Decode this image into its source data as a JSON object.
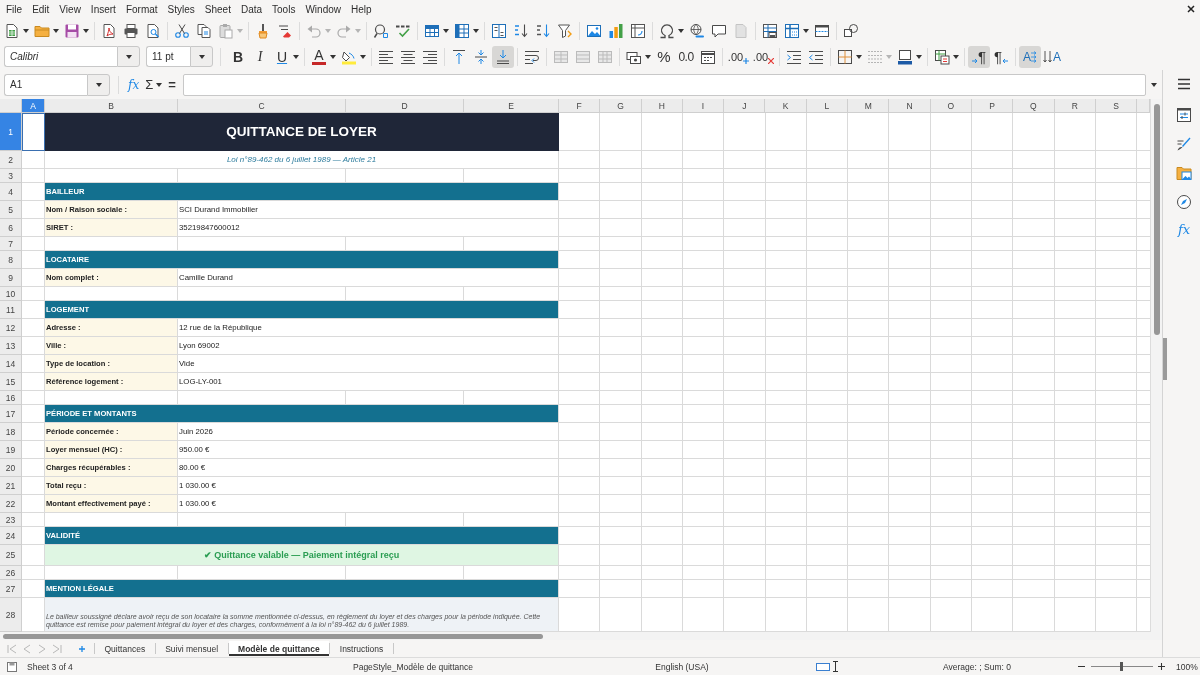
{
  "menu_bar": {
    "items": [
      "File",
      "Edit",
      "View",
      "Insert",
      "Format",
      "Styles",
      "Sheet",
      "Data",
      "Tools",
      "Window",
      "Help"
    ]
  },
  "formatting_toolbar": {
    "font_name": "Calibri",
    "font_size": "11 pt",
    "bold": "B",
    "italic": "I",
    "underline": "U",
    "font_color": "A",
    "align_top": {
      "on": false
    },
    "align_center": {
      "on": false
    },
    "align_bottom": {
      "on": true
    },
    "percent": "%",
    "number": "0.0",
    "add_decimal": ".00",
    "delete_decimal": ".00",
    "left_to_right": {
      "glyph": "¶",
      "on": true
    },
    "right_to_left": {
      "glyph": "¶",
      "on": false
    },
    "text_horizontal": {
      "glyph": "A",
      "on": true
    },
    "text_vertical": {
      "glyph": "A",
      "on": false
    }
  },
  "formula_bar": {
    "name_box": "A1",
    "function_wizard": "fx",
    "sum": "Σ",
    "formula": "="
  },
  "sidebar": {
    "functions": "fx"
  },
  "sheet": {
    "columns": [
      {
        "label": "A",
        "selected": true
      },
      {
        "label": "B",
        "selected": false
      },
      {
        "label": "C",
        "selected": false
      },
      {
        "label": "D",
        "selected": false
      },
      {
        "label": "E",
        "selected": false
      },
      {
        "label": "F",
        "selected": false
      },
      {
        "label": "G",
        "selected": false
      },
      {
        "label": "H",
        "selected": false
      },
      {
        "label": "I",
        "selected": false
      },
      {
        "label": "J",
        "selected": false
      },
      {
        "label": "K",
        "selected": false
      },
      {
        "label": "L",
        "selected": false
      },
      {
        "label": "M",
        "selected": false
      },
      {
        "label": "N",
        "selected": false
      },
      {
        "label": "O",
        "selected": false
      },
      {
        "label": "P",
        "selected": false
      },
      {
        "label": "Q",
        "selected": false
      },
      {
        "label": "R",
        "selected": false
      },
      {
        "label": "S",
        "selected": false
      }
    ],
    "rows": [
      {
        "number": "1",
        "selected": true,
        "kind": "title",
        "text": "QUITTANCE DE LOYER"
      },
      {
        "number": "2",
        "selected": false,
        "kind": "subtitle",
        "text": "Loi n°89-462 du 6 juillet 1989 — Article 21"
      },
      {
        "number": "3",
        "selected": false,
        "kind": "blank"
      },
      {
        "number": "4",
        "selected": false,
        "kind": "section",
        "text": "BAILLEUR"
      },
      {
        "number": "5",
        "selected": false,
        "kind": "field",
        "label": "Nom / Raison sociale :",
        "value": "SCI Durand Immobilier"
      },
      {
        "number": "6",
        "selected": false,
        "kind": "field",
        "label": "SIRET :",
        "value": "35219847600012"
      },
      {
        "number": "7",
        "selected": false,
        "kind": "blank"
      },
      {
        "number": "8",
        "selected": false,
        "kind": "section",
        "text": "LOCATAIRE"
      },
      {
        "number": "9",
        "selected": false,
        "kind": "field",
        "label": "Nom complet :",
        "value": "Camille Durand"
      },
      {
        "number": "10",
        "selected": false,
        "kind": "blank"
      },
      {
        "number": "11",
        "selected": false,
        "kind": "section",
        "text": "LOGEMENT"
      },
      {
        "number": "12",
        "selected": false,
        "kind": "field",
        "label": "Adresse :",
        "value": "12 rue de la République"
      },
      {
        "number": "13",
        "selected": false,
        "kind": "field",
        "label": "Ville :",
        "value": "Lyon 69002"
      },
      {
        "number": "14",
        "selected": false,
        "kind": "field",
        "label": "Type de location :",
        "value": "Vide"
      },
      {
        "number": "15",
        "selected": false,
        "kind": "field",
        "label": "Référence logement :",
        "value": "LOG-LY-001"
      },
      {
        "number": "16",
        "selected": false,
        "kind": "blank"
      },
      {
        "number": "17",
        "selected": false,
        "kind": "section",
        "text": "PÉRIODE ET MONTANTS"
      },
      {
        "number": "18",
        "selected": false,
        "kind": "field",
        "label": "Période concernée :",
        "value": "Juin 2026"
      },
      {
        "number": "19",
        "selected": false,
        "kind": "field",
        "label": "Loyer mensuel (HC) :",
        "value": "950.00 €"
      },
      {
        "number": "20",
        "selected": false,
        "kind": "field",
        "label": "Charges récupérables :",
        "value": "80.00 €"
      },
      {
        "number": "21",
        "selected": false,
        "kind": "field",
        "label": "Total reçu :",
        "value": "1 030.00 €"
      },
      {
        "number": "22",
        "selected": false,
        "kind": "field",
        "label": "Montant effectivement payé :",
        "value": "1 030.00 €"
      },
      {
        "number": "23",
        "selected": false,
        "kind": "blank"
      },
      {
        "number": "24",
        "selected": false,
        "kind": "section",
        "text": "VALIDITÉ"
      },
      {
        "number": "25",
        "selected": false,
        "kind": "status",
        "text": "✔ Quittance valable — Paiement intégral reçu"
      },
      {
        "number": "26",
        "selected": false,
        "kind": "blank"
      },
      {
        "number": "27",
        "selected": false,
        "kind": "section",
        "text": "MENTION LÉGALE"
      },
      {
        "number": "28",
        "selected": false,
        "kind": "note",
        "text": "Le bailleur soussigné déclare avoir reçu de son locataire la somme mentionnée ci-dessus, en règlement du loyer et des charges pour la période indiquée. Cette quittance est remise pour paiement intégral du loyer et des charges, conformément à la loi n°89-462 du 6 juillet 1989."
      }
    ]
  },
  "sheet_tabs": [
    {
      "label": "Quittances",
      "selected": false
    },
    {
      "label": "Suivi mensuel",
      "selected": false
    },
    {
      "label": "Modèle de quittance",
      "selected": true
    },
    {
      "label": "Instructions",
      "selected": false
    }
  ],
  "status_bar": {
    "sheet_position": "Sheet 3 of 4",
    "page_style": "PageStyle_Modèle de quittance",
    "language": "English (USA)",
    "selection_summary": "Average: ; Sum: 0",
    "zoom_slider": {
      "level": 0.5
    },
    "zoom": "100%"
  }
}
